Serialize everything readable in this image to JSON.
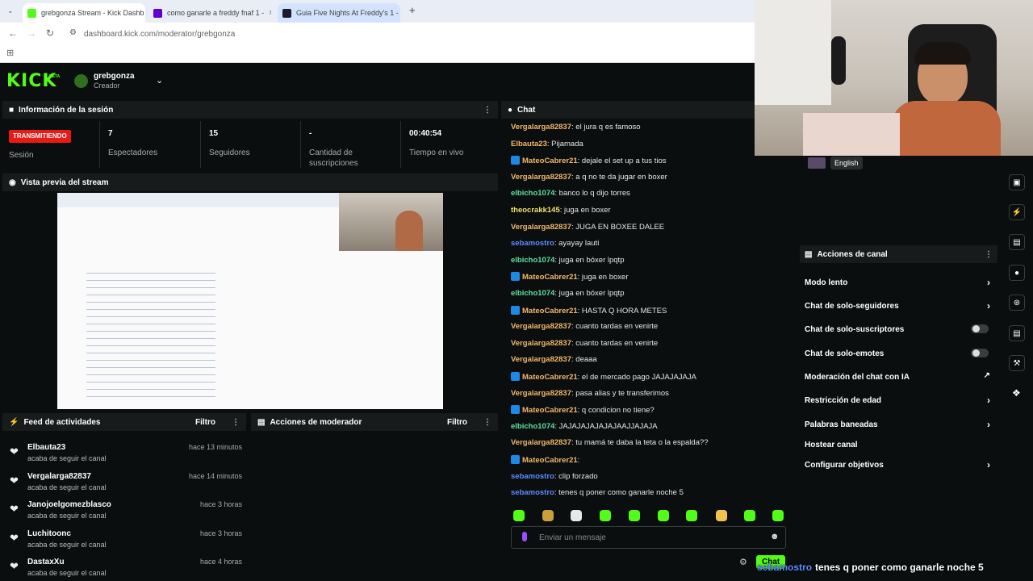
{
  "browser": {
    "tabs": [
      {
        "title": "grebgonza Stream - Kick Dashb",
        "color": "#53fc18",
        "active": true
      },
      {
        "title": "como ganarle a freddy fnaf 1 -",
        "color": "#6001d2",
        "active": false
      },
      {
        "title": "Guia Five Nights At Freddy's 1 -",
        "color": "#1c1c2e",
        "active": false
      }
    ],
    "url": "dashboard.kick.com/moderator/grebgonza"
  },
  "header": {
    "logo": "KICK",
    "logo_badge": "BETA",
    "username": "grebgonza",
    "role": "Creador"
  },
  "session": {
    "title": "Información de la sesión",
    "live_badge": "TRANSMITIENDO",
    "live_label": "Sesión",
    "stats": [
      {
        "value": "7",
        "label": "Espectadores"
      },
      {
        "value": "15",
        "label": "Seguidores"
      },
      {
        "value": "-",
        "label": "Cantidad de suscripciones"
      },
      {
        "value": "00:40:54",
        "label": "Tiempo en vivo"
      }
    ]
  },
  "preview": {
    "title": "Vista previa del stream"
  },
  "feed": {
    "title": "Feed de actividades",
    "filter": "Filtro",
    "items": [
      {
        "name": "Elbauta23",
        "sub": "acaba de seguir el canal",
        "time": "hace 13 minutos"
      },
      {
        "name": "Vergalarga82837",
        "sub": "acaba de seguir el canal",
        "time": "hace 14 minutos"
      },
      {
        "name": "Janojoelgomezblasco",
        "sub": "acaba de seguir el canal",
        "time": "hace 3 horas"
      },
      {
        "name": "Luchitoonc",
        "sub": "acaba de seguir el canal",
        "time": "hace 3 horas"
      },
      {
        "name": "DastaxXu",
        "sub": "acaba de seguir el canal",
        "time": "hace 4 horas"
      }
    ]
  },
  "mod_actions": {
    "title": "Acciones de moderador",
    "filter": "Filtro"
  },
  "chat": {
    "title": "Chat",
    "messages": [
      {
        "user": "Vergalarga82837",
        "text": ": el jura q es famoso",
        "color": "#f2b86b",
        "mod": false
      },
      {
        "user": "Elbauta23",
        "text": ": Pijamada",
        "color": "#f2b86b",
        "mod": false
      },
      {
        "user": "MateoCabrer21",
        "text": ": dejale el set up a tus tios",
        "color": "#f2b86b",
        "mod": true
      },
      {
        "user": "Vergalarga82837",
        "text": ": a q no te da jugar en boxer",
        "color": "#f2b86b",
        "mod": false
      },
      {
        "user": "elbicho1074",
        "text": ": banco lo q dijo torres",
        "color": "#5ee0a0",
        "mod": false
      },
      {
        "user": "theocrakk145",
        "text": ": juga en boxer",
        "color": "#f0e26a",
        "mod": false
      },
      {
        "user": "Vergalarga82837",
        "text": ": JUGA EN BOXEE DALEE",
        "color": "#f2b86b",
        "mod": false
      },
      {
        "user": "sebamostro",
        "text": ": ayayay lauti",
        "color": "#5b8cff",
        "mod": false
      },
      {
        "user": "elbicho1074",
        "text": ": juga en bóxer lpqtp",
        "color": "#5ee0a0",
        "mod": false
      },
      {
        "user": "MateoCabrer21",
        "text": ": juga en boxer",
        "color": "#f2b86b",
        "mod": true
      },
      {
        "user": "elbicho1074",
        "text": ": juga en bóxer lpqtp",
        "color": "#5ee0a0",
        "mod": false
      },
      {
        "user": "MateoCabrer21",
        "text": ": HASTA Q HORA METES",
        "color": "#f2b86b",
        "mod": true
      },
      {
        "user": "Vergalarga82837",
        "text": ": cuanto tardas en venirte",
        "color": "#f2b86b",
        "mod": false
      },
      {
        "user": "Vergalarga82837",
        "text": ": cuanto tardas en venirte",
        "color": "#f2b86b",
        "mod": false
      },
      {
        "user": "Vergalarga82837",
        "text": ": deaaa",
        "color": "#f2b86b",
        "mod": false
      },
      {
        "user": "MateoCabrer21",
        "text": ": el de mercado pago JAJAJAJAJA",
        "color": "#f2b86b",
        "mod": true
      },
      {
        "user": "Vergalarga82837",
        "text": ": pasa alias y te transferimos",
        "color": "#f2b86b",
        "mod": false
      },
      {
        "user": "MateoCabrer21",
        "text": ": q condicion no tiene?",
        "color": "#f2b86b",
        "mod": true
      },
      {
        "user": "elbicho1074",
        "text": ": JAJAJAJAJAJAJAAJJAJAJA",
        "color": "#5ee0a0",
        "mod": false
      },
      {
        "user": "Vergalarga82837",
        "text": ": tu mamá te daba la teta o la espalda??",
        "color": "#f2b86b",
        "mod": false
      },
      {
        "user": "MateoCabrer21",
        "text": ":",
        "color": "#f2b86b",
        "mod": true
      },
      {
        "user": "sebamostro",
        "text": ": clip forzado",
        "color": "#5b8cff",
        "mod": false
      },
      {
        "user": "sebamostro",
        "text": ": tenes q poner como ganarle noche 5",
        "color": "#5b8cff",
        "mod": false
      }
    ],
    "input_placeholder": "Enviar un mensaje",
    "send_label": "Chat"
  },
  "language": "English",
  "channel_actions": {
    "title": "Acciones de canal",
    "items": [
      {
        "label": "Modo lento",
        "control": "chevron"
      },
      {
        "label": "Chat de solo-seguidores",
        "control": "chevron"
      },
      {
        "label": "Chat de solo-suscriptores",
        "control": "toggle"
      },
      {
        "label": "Chat de solo-emotes",
        "control": "toggle"
      },
      {
        "label": "Moderación del chat con IA",
        "control": "external"
      },
      {
        "label": "Restricción de edad",
        "control": "chevron"
      },
      {
        "label": "Palabras baneadas",
        "control": "chevron"
      },
      {
        "label": "Hostear canal",
        "control": "none"
      },
      {
        "label": "Configurar objetivos",
        "control": "chevron"
      }
    ]
  },
  "overlay_caption": {
    "user": "sebamostro",
    "text": "tenes q poner como ganarle noche 5"
  },
  "colors": {
    "kick_green": "#53fc18",
    "live_red": "#e91916",
    "panel_bg": "#0b0e0f",
    "header_bg": "#181b1c"
  }
}
